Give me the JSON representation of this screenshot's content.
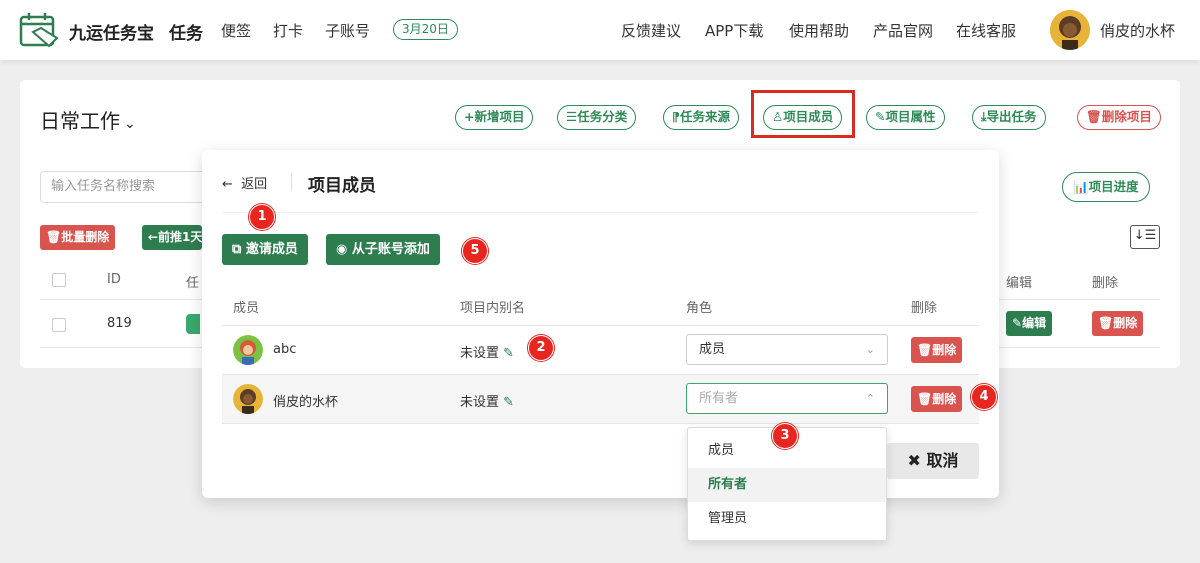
{
  "topbar": {
    "brand": "九运任务宝",
    "nav_task": "任务",
    "nav_notes": "便签",
    "nav_checkin": "打卡",
    "nav_subaccount": "子账号",
    "date": "3月20日",
    "feedback": "反馈建议",
    "app_download": "APP下载",
    "help": "使用帮助",
    "official_site": "产品官网",
    "online_service": "在线客服",
    "user_name": "俏皮的水杯"
  },
  "project": {
    "title": "日常工作",
    "buttons": {
      "new_project": "+新增项目",
      "task_category": "☰任务分类",
      "task_source": "⁋任务来源",
      "project_members": "项目成员",
      "project_props": "项目属性",
      "export_tasks": "导出任务",
      "delete_project": "删除项目"
    },
    "search_placeholder": "输入任务名称搜索",
    "progress": "项目进度",
    "bulk_delete": "批量删除",
    "push_forward": "←前推1天",
    "table": {
      "headers": {
        "id": "ID",
        "task": "任",
        "edit": "编辑",
        "delete": "删除"
      },
      "rows": [
        {
          "id": "819",
          "edit": "编辑",
          "delete": "删除"
        }
      ]
    }
  },
  "modal": {
    "back": "返回",
    "title": "项目成员",
    "invite": "邀请成员",
    "add_from_sub": "从子账号添加",
    "headers": {
      "member": "成员",
      "alias": "项目内别名",
      "role": "角色",
      "delete": "删除"
    },
    "members": [
      {
        "name": "abc",
        "alias": "未设置",
        "role": "成员",
        "delete": "删除"
      },
      {
        "name": "俏皮的水杯",
        "alias": "未设置",
        "role_placeholder": "所有者",
        "delete": "删除"
      }
    ],
    "cancel": "取消"
  },
  "dropdown": {
    "options": [
      "成员",
      "所有者",
      "管理员"
    ],
    "selected": "所有者"
  },
  "markers": [
    "1",
    "2",
    "3",
    "4",
    "5"
  ],
  "colors": {
    "primary": "#2e7d4f",
    "danger": "#d9534f",
    "marker": "#e8261f"
  }
}
